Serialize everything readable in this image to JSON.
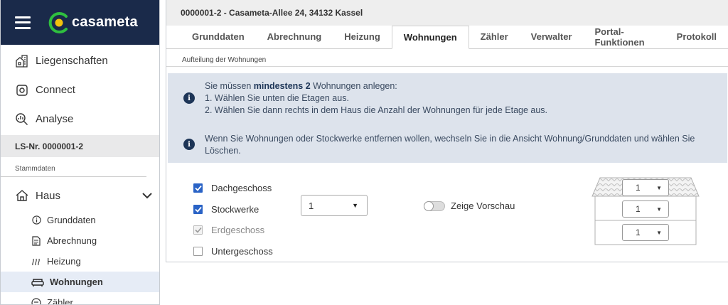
{
  "brand": {
    "name": "casameta"
  },
  "sidebar": {
    "nav": [
      {
        "label": "Liegenschaften",
        "icon": "buildings-icon"
      },
      {
        "label": "Connect",
        "icon": "connect-icon"
      },
      {
        "label": "Analyse",
        "icon": "analyse-icon"
      }
    ],
    "ls_number": "LS-Nr. 0000001-2",
    "section_label": "Stammdaten",
    "haus": {
      "label": "Haus"
    },
    "subitems": [
      {
        "label": "Grunddaten",
        "icon": "info-icon"
      },
      {
        "label": "Abrechnung",
        "icon": "document-icon"
      },
      {
        "label": "Heizung",
        "icon": "heating-icon"
      },
      {
        "label": "Wohnungen",
        "icon": "sofa-icon",
        "active": true
      },
      {
        "label": "Zähler",
        "icon": "meter-icon"
      }
    ]
  },
  "main": {
    "header": "0000001-2 - Casameta-Allee 24, 34132 Kassel",
    "tabs": [
      {
        "label": "Grunddaten"
      },
      {
        "label": "Abrechnung"
      },
      {
        "label": "Heizung"
      },
      {
        "label": "Wohnungen",
        "active": true
      },
      {
        "label": "Zähler"
      },
      {
        "label": "Verwalter"
      },
      {
        "label": "Portal-Funktionen"
      },
      {
        "label": "Protokoll"
      }
    ],
    "section_label": "Aufteilung der Wohnungen",
    "info1": {
      "line1_pre": "Sie müssen ",
      "line1_bold": "mindestens 2",
      "line1_post": " Wohnungen anlegen:",
      "line2": "1. Wählen Sie unten die Etagen aus.",
      "line3": "2. Wählen Sie dann rechts in dem Haus die Anzahl der Wohnungen für jede Etage aus."
    },
    "info2": {
      "line1": "Wenn Sie Wohnungen oder Stockwerke entfernen wollen, wechseln Sie in die Ansicht Wohnung/Grunddaten und wählen Sie",
      "line2": "Löschen."
    },
    "floors": [
      {
        "label": "Dachgeschoss",
        "checked": true,
        "disabled": false
      },
      {
        "label": "Stockwerke",
        "checked": true,
        "disabled": false
      },
      {
        "label": "Erdgeschoss",
        "checked": true,
        "disabled": true
      },
      {
        "label": "Untergeschoss",
        "checked": false,
        "disabled": false
      }
    ],
    "stockwerke_select": {
      "value": "1"
    },
    "preview_toggle": {
      "label": "Zeige Vorschau",
      "on": false
    },
    "house_selects": [
      {
        "value": "1"
      },
      {
        "value": "1"
      },
      {
        "value": "1"
      }
    ]
  }
}
